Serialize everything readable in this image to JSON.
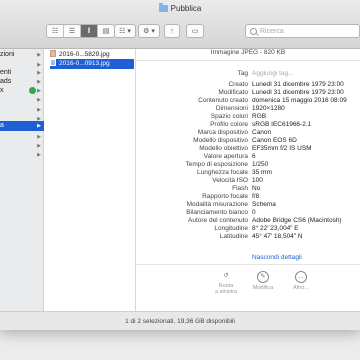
{
  "window": {
    "title": "Pubblica"
  },
  "toolbar": {
    "view_icons": [
      "☷",
      "☰",
      "‖",
      "▤"
    ],
    "arrange_label": "☷ ▾",
    "action_label": "⚙ ▾",
    "share_label": "↑",
    "tag_label": "▭",
    "search_placeholder": "Ricerca"
  },
  "sidebar": {
    "items": [
      {
        "label": "zioni"
      },
      {
        "label": ""
      },
      {
        "label": "enti"
      },
      {
        "label": "ads"
      },
      {
        "label": "x"
      },
      {
        "label": ""
      },
      {
        "label": ""
      },
      {
        "label": ""
      },
      {
        "label": ""
      },
      {
        "label": "a"
      },
      {
        "label": ""
      },
      {
        "label": ""
      },
      {
        "label": ""
      }
    ]
  },
  "files": [
    {
      "name": "2016-0...5829.jpg"
    },
    {
      "name": "2016-0...0913.jpg"
    }
  ],
  "preview": {
    "kind": "Immagine JPEG - 820 KB",
    "rows": [
      {
        "key": "Tag",
        "value": "Aggiungi tag..."
      },
      {
        "key": "Creato",
        "value": "Lunedì 31 dicembre 1979 23:00"
      },
      {
        "key": "Modificato",
        "value": "Lunedì 31 dicembre 1979 23:00"
      },
      {
        "key": "Contenuto creato",
        "value": "domenica 15 maggio 2016 08:09"
      },
      {
        "key": "Dimensioni",
        "value": "1920×1280"
      },
      {
        "key": "Spazio colori",
        "value": "RGB"
      },
      {
        "key": "Profilo colore",
        "value": "sRGB IEC61966-2.1"
      },
      {
        "key": "Marca dispositivo",
        "value": "Canon"
      },
      {
        "key": "Modello dispositivo",
        "value": "Canon EOS 6D"
      },
      {
        "key": "Modello obiettivo",
        "value": "EF35mm f/2 IS USM"
      },
      {
        "key": "Valore apertura",
        "value": "6"
      },
      {
        "key": "Tempo di esposizione",
        "value": "1/250"
      },
      {
        "key": "Lunghezza focale",
        "value": "35 mm"
      },
      {
        "key": "Velocità ISO",
        "value": "100"
      },
      {
        "key": "Flash",
        "value": "No"
      },
      {
        "key": "Rapporto focale",
        "value": "f/8"
      },
      {
        "key": "Modalità misurazione",
        "value": "Schema"
      },
      {
        "key": "Bilanciamento bianco",
        "value": "0"
      },
      {
        "key": "Autore del contenuto",
        "value": "Adobe Bridge CS6 (Macintosh)"
      },
      {
        "key": "Longitudine",
        "value": "8° 22' 23,004\" E"
      },
      {
        "key": "Latitudine",
        "value": "45° 47' 18,504\" N"
      }
    ],
    "hide_details": "Nascondi dettagli",
    "actions": [
      {
        "label": "Ruota\na sinistra",
        "icon": "↺"
      },
      {
        "label": "Modifica",
        "icon": "✎"
      },
      {
        "label": "Altro...",
        "icon": "…"
      }
    ]
  },
  "status": {
    "text": "1 di 2 selezionati, 19,36 GB disponibili"
  }
}
